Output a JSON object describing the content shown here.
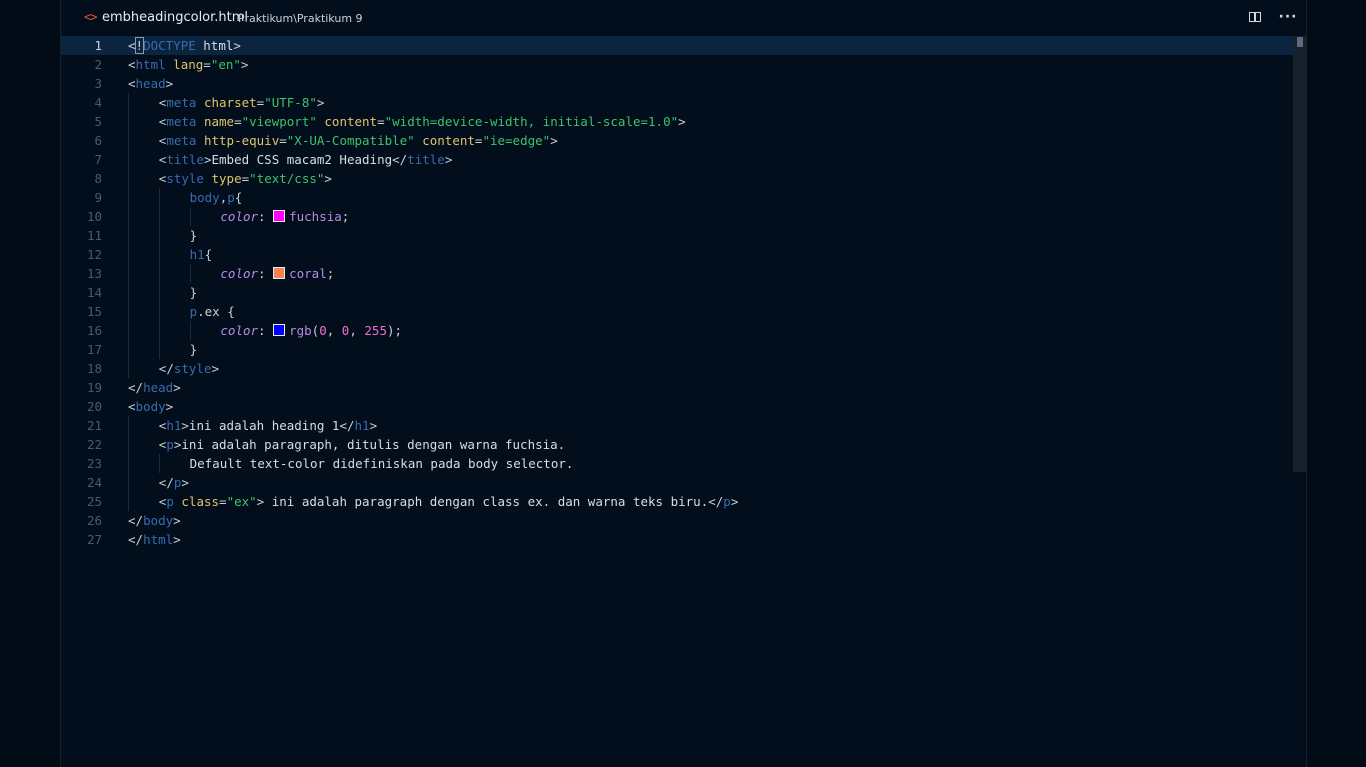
{
  "tab": {
    "icon": "html-code-icon",
    "filename": "embheadingcolor.html",
    "path": "Praktikum\\Praktikum 9"
  },
  "actions": {
    "split": "split-editor-icon",
    "more": "more-actions-icon",
    "more_glyph": "···"
  },
  "editor": {
    "current_line": 1,
    "lines": [
      {
        "n": "1",
        "indent": 0,
        "tokens": [
          [
            "punc",
            "<"
          ],
          [
            "hl",
            "!"
          ],
          [
            "doc",
            "DOCTYPE"
          ],
          [
            "text",
            " html"
          ],
          [
            "punc",
            ">"
          ]
        ]
      },
      {
        "n": "2",
        "indent": 0,
        "tokens": [
          [
            "punc",
            "<"
          ],
          [
            "tag",
            "html"
          ],
          [
            "text",
            " "
          ],
          [
            "attr",
            "lang"
          ],
          [
            "punc",
            "="
          ],
          [
            "str",
            "\"en\""
          ],
          [
            "punc",
            ">"
          ]
        ]
      },
      {
        "n": "3",
        "indent": 0,
        "tokens": [
          [
            "punc",
            "<"
          ],
          [
            "tag",
            "head"
          ],
          [
            "punc",
            ">"
          ]
        ]
      },
      {
        "n": "4",
        "indent": 1,
        "tokens": [
          [
            "punc",
            "<"
          ],
          [
            "tag",
            "meta"
          ],
          [
            "text",
            " "
          ],
          [
            "attr",
            "charset"
          ],
          [
            "punc",
            "="
          ],
          [
            "str",
            "\"UTF-8\""
          ],
          [
            "punc",
            ">"
          ]
        ]
      },
      {
        "n": "5",
        "indent": 1,
        "tokens": [
          [
            "punc",
            "<"
          ],
          [
            "tag",
            "meta"
          ],
          [
            "text",
            " "
          ],
          [
            "attr",
            "name"
          ],
          [
            "punc",
            "="
          ],
          [
            "str",
            "\"viewport\""
          ],
          [
            "text",
            " "
          ],
          [
            "attr",
            "content"
          ],
          [
            "punc",
            "="
          ],
          [
            "str",
            "\"width=device-width, initial-scale=1.0\""
          ],
          [
            "punc",
            ">"
          ]
        ]
      },
      {
        "n": "6",
        "indent": 1,
        "tokens": [
          [
            "punc",
            "<"
          ],
          [
            "tag",
            "meta"
          ],
          [
            "text",
            " "
          ],
          [
            "attr",
            "http-equiv"
          ],
          [
            "punc",
            "="
          ],
          [
            "str",
            "\"X-UA-Compatible\""
          ],
          [
            "text",
            " "
          ],
          [
            "attr",
            "content"
          ],
          [
            "punc",
            "="
          ],
          [
            "str",
            "\"ie=edge\""
          ],
          [
            "punc",
            ">"
          ]
        ]
      },
      {
        "n": "7",
        "indent": 1,
        "tokens": [
          [
            "punc",
            "<"
          ],
          [
            "tag",
            "title"
          ],
          [
            "punc",
            ">"
          ],
          [
            "text",
            "Embed CSS macam2 Heading"
          ],
          [
            "punc",
            "</"
          ],
          [
            "tag",
            "title"
          ],
          [
            "punc",
            ">"
          ]
        ]
      },
      {
        "n": "8",
        "indent": 1,
        "tokens": [
          [
            "punc",
            "<"
          ],
          [
            "tag",
            "style"
          ],
          [
            "text",
            " "
          ],
          [
            "attr",
            "type"
          ],
          [
            "punc",
            "="
          ],
          [
            "str",
            "\"text/css\""
          ],
          [
            "punc",
            ">"
          ]
        ]
      },
      {
        "n": "9",
        "indent": 2,
        "tokens": [
          [
            "sel",
            "body"
          ],
          [
            "punc",
            ","
          ],
          [
            "sel",
            "p"
          ],
          [
            "punc",
            "{"
          ]
        ]
      },
      {
        "n": "10",
        "indent": 3,
        "tokens": [
          [
            "prop",
            "color"
          ],
          [
            "punc",
            ": "
          ],
          [
            "swatch",
            "#ff00ff"
          ],
          [
            "val",
            "fuchsia"
          ],
          [
            "punc",
            ";"
          ]
        ]
      },
      {
        "n": "11",
        "indent": 2,
        "tokens": [
          [
            "punc",
            "}"
          ]
        ]
      },
      {
        "n": "12",
        "indent": 2,
        "tokens": [
          [
            "sel",
            "h1"
          ],
          [
            "punc",
            "{"
          ]
        ]
      },
      {
        "n": "13",
        "indent": 3,
        "tokens": [
          [
            "prop",
            "color"
          ],
          [
            "punc",
            ": "
          ],
          [
            "swatch",
            "#ff7f50"
          ],
          [
            "val",
            "coral"
          ],
          [
            "punc",
            ";"
          ]
        ]
      },
      {
        "n": "14",
        "indent": 2,
        "tokens": [
          [
            "punc",
            "}"
          ]
        ]
      },
      {
        "n": "15",
        "indent": 2,
        "tokens": [
          [
            "sel",
            "p"
          ],
          [
            "punc",
            ".ex {"
          ]
        ]
      },
      {
        "n": "16",
        "indent": 3,
        "tokens": [
          [
            "prop",
            "color"
          ],
          [
            "punc",
            ": "
          ],
          [
            "swatch",
            "#0000ff"
          ],
          [
            "val",
            "rgb"
          ],
          [
            "punc",
            "("
          ],
          [
            "num",
            "0"
          ],
          [
            "punc",
            ", "
          ],
          [
            "num",
            "0"
          ],
          [
            "punc",
            ", "
          ],
          [
            "num",
            "255"
          ],
          [
            "punc",
            ");"
          ]
        ]
      },
      {
        "n": "17",
        "indent": 2,
        "tokens": [
          [
            "punc",
            "}"
          ]
        ]
      },
      {
        "n": "18",
        "indent": 1,
        "tokens": [
          [
            "punc",
            "</"
          ],
          [
            "tag",
            "style"
          ],
          [
            "punc",
            ">"
          ]
        ]
      },
      {
        "n": "19",
        "indent": 0,
        "tokens": [
          [
            "punc",
            "</"
          ],
          [
            "tag",
            "head"
          ],
          [
            "punc",
            ">"
          ]
        ]
      },
      {
        "n": "20",
        "indent": 0,
        "tokens": [
          [
            "punc",
            "<"
          ],
          [
            "tag",
            "body"
          ],
          [
            "punc",
            ">"
          ]
        ]
      },
      {
        "n": "21",
        "indent": 1,
        "tokens": [
          [
            "punc",
            "<"
          ],
          [
            "tag",
            "h1"
          ],
          [
            "punc",
            ">"
          ],
          [
            "text",
            "ini adalah heading 1"
          ],
          [
            "punc",
            "</"
          ],
          [
            "tag",
            "h1"
          ],
          [
            "punc",
            ">"
          ]
        ]
      },
      {
        "n": "22",
        "indent": 1,
        "tokens": [
          [
            "punc",
            "<"
          ],
          [
            "tag",
            "p"
          ],
          [
            "punc",
            ">"
          ],
          [
            "text",
            "ini adalah paragraph, ditulis dengan warna fuchsia."
          ]
        ]
      },
      {
        "n": "23",
        "indent": 2,
        "tokens": [
          [
            "text",
            "Default text-color didefiniskan pada body selector."
          ]
        ]
      },
      {
        "n": "24",
        "indent": 1,
        "tokens": [
          [
            "punc",
            "</"
          ],
          [
            "tag",
            "p"
          ],
          [
            "punc",
            ">"
          ]
        ]
      },
      {
        "n": "25",
        "indent": 1,
        "tokens": [
          [
            "punc",
            "<"
          ],
          [
            "tag",
            "p"
          ],
          [
            "text",
            " "
          ],
          [
            "attr",
            "class"
          ],
          [
            "punc",
            "="
          ],
          [
            "str",
            "\"ex\""
          ],
          [
            "punc",
            ">"
          ],
          [
            "text",
            " ini adalah paragraph dengan class ex. dan warna teks biru."
          ],
          [
            "punc",
            "</"
          ],
          [
            "tag",
            "p"
          ],
          [
            "punc",
            ">"
          ]
        ]
      },
      {
        "n": "26",
        "indent": 0,
        "tokens": [
          [
            "punc",
            "</"
          ],
          [
            "tag",
            "body"
          ],
          [
            "punc",
            ">"
          ]
        ]
      },
      {
        "n": "27",
        "indent": 0,
        "tokens": [
          [
            "punc",
            "</"
          ],
          [
            "tag",
            "html"
          ],
          [
            "punc",
            ">"
          ]
        ]
      }
    ]
  }
}
